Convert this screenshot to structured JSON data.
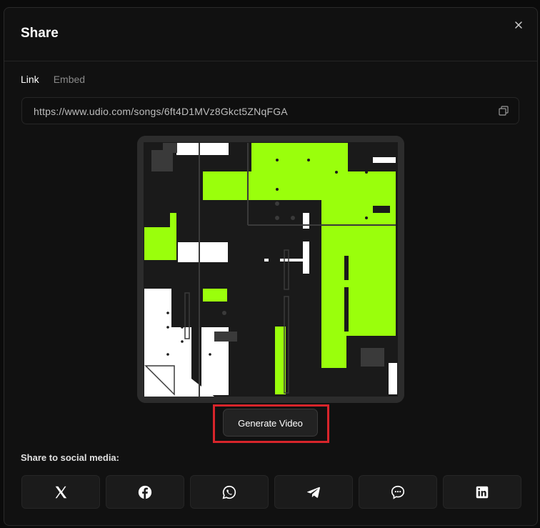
{
  "modal": {
    "title": "Share",
    "tabs": [
      {
        "label": "Link",
        "active": true
      },
      {
        "label": "Embed",
        "active": false
      }
    ],
    "link_url": "https://www.udio.com/songs/6ft4D1MVz8Gkct5ZNqFGA",
    "generate_video_label": "Generate Video",
    "share_label": "Share to social media:",
    "social": [
      "x-icon",
      "facebook-icon",
      "whatsapp-icon",
      "telegram-icon",
      "messenger-icon",
      "linkedin-icon"
    ]
  },
  "colors": {
    "accent_green": "#9aff0c",
    "highlight_red": "#d8252b",
    "panel_bg": "#111111"
  }
}
